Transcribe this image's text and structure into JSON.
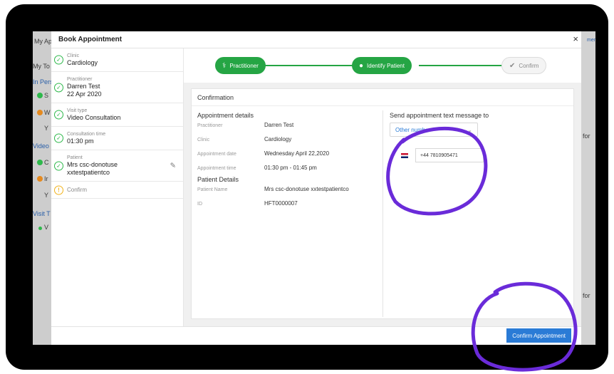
{
  "background": {
    "tab_fragment": "My App",
    "nav_fragment_1": "My To",
    "nav_fragment_2": "In Pers",
    "nav_fragment_3": "Video",
    "nav_fragment_4": "Visit T",
    "letters": [
      "S",
      "W",
      "Y",
      "C",
      "Ir",
      "Y",
      "V"
    ],
    "right_fragments": [
      "for",
      "for"
    ],
    "top_right_fragment": "men"
  },
  "modal": {
    "title": "Book Appointment",
    "close_label": "×"
  },
  "steps": [
    {
      "label": "Clinic",
      "value": "Cardiology",
      "status": "done"
    },
    {
      "label": "Practitioner",
      "value": "Darren Test",
      "value2": "22 Apr 2020",
      "status": "done"
    },
    {
      "label": "Visit type",
      "value": "Video Consultation",
      "status": "done"
    },
    {
      "label": "Consultation time",
      "value": "01:30 pm",
      "status": "done"
    },
    {
      "label": "Patient",
      "value": "Mrs csc-donotuse",
      "value2": "xxtestpatientco",
      "status": "done"
    },
    {
      "label": "Confirm",
      "status": "pending"
    }
  ],
  "progress": {
    "steps": [
      "Practitioner",
      "Identify Patient",
      "Confirm"
    ]
  },
  "confirmation": {
    "title": "Confirmation",
    "appointment_section": "Appointment details",
    "patient_section": "Patient Details",
    "fields": [
      {
        "key": "Practitioner",
        "value": "Darren Test"
      },
      {
        "key": "Clinic",
        "value": "Cardiology"
      },
      {
        "key": "Appointment date",
        "value": "Wednesday April 22,2020"
      },
      {
        "key": "Appointment time",
        "value": "01:30 pm - 01:45 pm"
      }
    ],
    "patient_fields": [
      {
        "key": "Patient Name",
        "value": "Mrs csc-donotuse xxtestpatientco"
      },
      {
        "key": "ID",
        "value": "HFT0000007"
      }
    ]
  },
  "sms": {
    "title": "Send appointment text message to",
    "selected_option": "Other number",
    "phone_value": "+44 7810905471"
  },
  "footer": {
    "confirm_label": "Confirm Appointment"
  },
  "colors": {
    "accent_green": "#25a544",
    "primary_blue": "#2a7bd6",
    "annotation_purple": "#6a2bd9"
  }
}
